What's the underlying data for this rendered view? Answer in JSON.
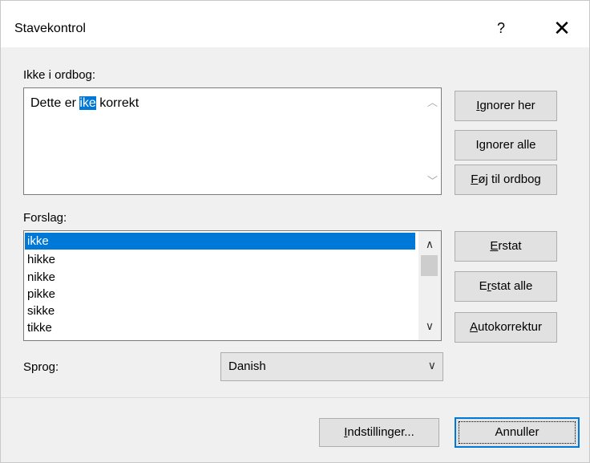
{
  "window": {
    "title": "Stavekontrol",
    "help_label": "?",
    "close_label": "✕"
  },
  "not_in_dict": {
    "label": "Ikke i ordbog:",
    "text_before": "Dette er ",
    "text_highlight": "ike",
    "text_after": " korrekt"
  },
  "side_buttons": {
    "ignore_once": {
      "accel": "I",
      "rest_before": "",
      "rest": "gnorer her",
      "full": "Ignorer her"
    },
    "ignore_all": {
      "accel": "g",
      "pre": "I",
      "rest": "norer alle"
    },
    "add_dict": {
      "accel": "F",
      "rest": "øj til ordbog"
    },
    "replace": {
      "accel": "E",
      "rest": "rstat"
    },
    "replace_all": {
      "pre": "E",
      "accel": "r",
      "rest": "stat alle"
    },
    "autocorrect": {
      "accel": "A",
      "rest": "utokorrektur"
    }
  },
  "suggestions": {
    "label": "Forslag:",
    "items": [
      "ikke",
      "hikke",
      "nikke",
      "pikke",
      "sikke",
      "tikke"
    ],
    "selected_index": 0
  },
  "language": {
    "label": "Sprog:",
    "value": "Danish"
  },
  "footer": {
    "options": {
      "accel": "I",
      "rest": "ndstillinger..."
    },
    "cancel_label": "Annuller"
  },
  "colors": {
    "selection": "#0078d7",
    "button_face": "#e1e1e1",
    "dialog_bg": "#f0f0f0"
  }
}
